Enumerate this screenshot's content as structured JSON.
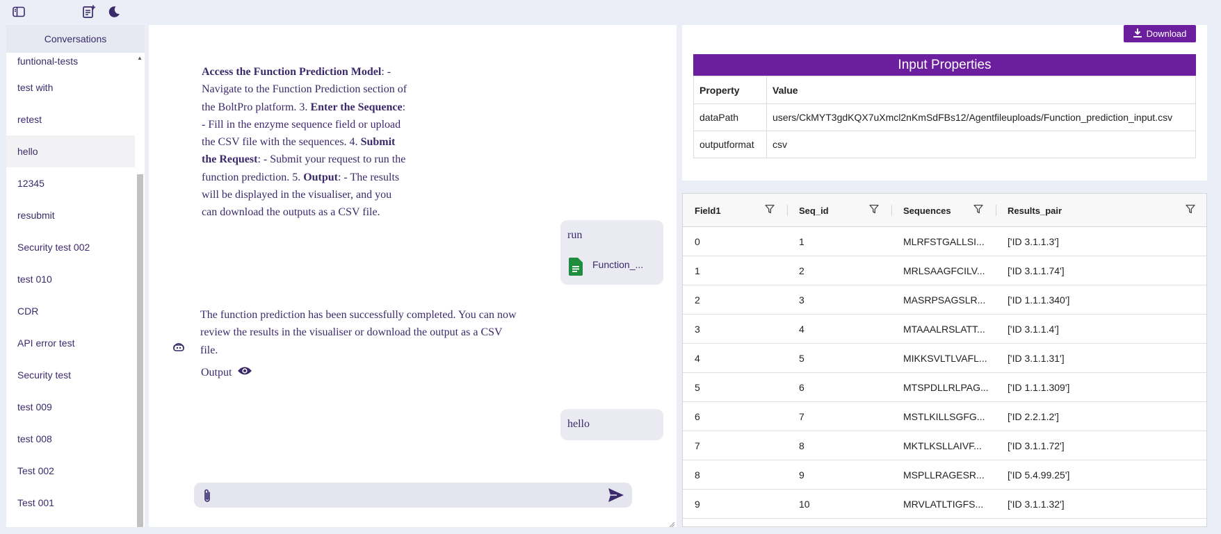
{
  "topbar": {
    "icons": [
      "sidebar-toggle-icon",
      "new-note-icon",
      "moon-icon"
    ]
  },
  "sidebar": {
    "header": "Conversations",
    "items": [
      {
        "label": "funtional-tests"
      },
      {
        "label": "test with"
      },
      {
        "label": "retest"
      },
      {
        "label": "hello"
      },
      {
        "label": "12345"
      },
      {
        "label": "resubmit"
      },
      {
        "label": "Security test 002"
      },
      {
        "label": "test 010"
      },
      {
        "label": "CDR"
      },
      {
        "label": "API error test"
      },
      {
        "label": "Security test"
      },
      {
        "label": "test 009"
      },
      {
        "label": "test 008"
      },
      {
        "label": "Test 002"
      },
      {
        "label": "Test 001"
      }
    ],
    "active_index": 3
  },
  "chat": {
    "bot_message_1": {
      "lines": [
        [
          {
            "b": "Access the Function Prediction Model"
          },
          {
            "t": ": -"
          }
        ],
        [
          {
            "t": "Navigate to the Function Prediction section of"
          }
        ],
        [
          {
            "t": "the BoltPro platform. 3. "
          },
          {
            "b": "Enter the Sequence"
          },
          {
            "t": ":"
          }
        ],
        [
          {
            "t": "- Fill in the enzyme sequence field or upload"
          }
        ],
        [
          {
            "t": "the CSV file with the sequences. 4. "
          },
          {
            "b": "Submit"
          }
        ],
        [
          {
            "b": "the Request"
          },
          {
            "t": ": - Submit your request to run the"
          }
        ],
        [
          {
            "t": "function prediction. 5. "
          },
          {
            "b": "Output"
          },
          {
            "t": ": - The results"
          }
        ],
        [
          {
            "t": "will be displayed in the visualiser, and you"
          }
        ],
        [
          {
            "t": "can download the outputs as a CSV file."
          }
        ]
      ]
    },
    "user_message_1": {
      "text": "run",
      "attachment": "Function_..."
    },
    "bot_message_2": {
      "lines": [
        "The function prediction has been successfully completed. You can now",
        "review the results in the visualiser or download the output as a CSV",
        "file."
      ],
      "output_label": "Output"
    },
    "user_message_2": {
      "text": "hello"
    },
    "composer": {
      "value": "",
      "placeholder": ""
    }
  },
  "properties": {
    "download_label": "Download",
    "title": "Input Properties",
    "col_property": "Property",
    "col_value": "Value",
    "rows": [
      {
        "property": "dataPath",
        "value": "users/CkMYT3gdKQX7uXmcl2nKmSdFBs12/Agentfileuploads/Function_prediction_input.csv"
      },
      {
        "property": "outputformat",
        "value": "csv"
      }
    ]
  },
  "grid": {
    "columns": [
      "Field1",
      "Seq_id",
      "Sequences",
      "Results_pair"
    ],
    "rows": [
      [
        "0",
        "1",
        "MLRFSTGALLSI...",
        "['ID 3.1.1.3']"
      ],
      [
        "1",
        "2",
        "MRLSAAGFCILV...",
        "['ID 3.1.1.74']"
      ],
      [
        "2",
        "3",
        "MASRPSAGSLR...",
        "['ID 1.1.1.340']"
      ],
      [
        "3",
        "4",
        "MTAAALRSLATT...",
        "['ID 3.1.1.4']"
      ],
      [
        "4",
        "5",
        "MIKKSVLTLVAFL...",
        "['ID 3.1.1.31']"
      ],
      [
        "5",
        "6",
        "MTSPDLLRLPAG...",
        "['ID 1.1.1.309']"
      ],
      [
        "6",
        "7",
        "MSTLKILLSGFG...",
        "['ID 2.2.1.2']"
      ],
      [
        "7",
        "8",
        "MKTLKSLLAIVF...",
        "['ID 3.1.1.72']"
      ],
      [
        "8",
        "9",
        "MSPLLRAGESR...",
        "['ID 5.4.99.25']"
      ],
      [
        "9",
        "10",
        "MRVLATLTIGFS...",
        "['ID 3.1.1.32']"
      ]
    ]
  },
  "colors": {
    "accent": "#6b1f9e",
    "text": "#3b2a6b",
    "background": "#eceef7",
    "csv_icon": "#1e8e3e"
  }
}
